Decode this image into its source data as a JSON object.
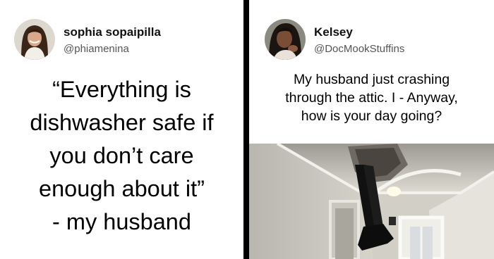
{
  "left_tweet": {
    "display_name": "sophia sopaipilla",
    "handle": "@phiamenina",
    "text_lines": [
      "“Everything is",
      "dishwasher safe if",
      "you don’t care",
      "enough about it”",
      "- my husband"
    ]
  },
  "right_tweet": {
    "display_name": "Kelsey",
    "handle": "@DocMookStuffins",
    "text_lines": [
      "My husband just crashing",
      "through the attic. I - Anyway,",
      "how is your day going?"
    ],
    "photo_icon": "attic-ceiling-legs-photo"
  },
  "colors": {
    "background": "#000000",
    "panel": "#ffffff",
    "handle_gray": "#555555"
  }
}
